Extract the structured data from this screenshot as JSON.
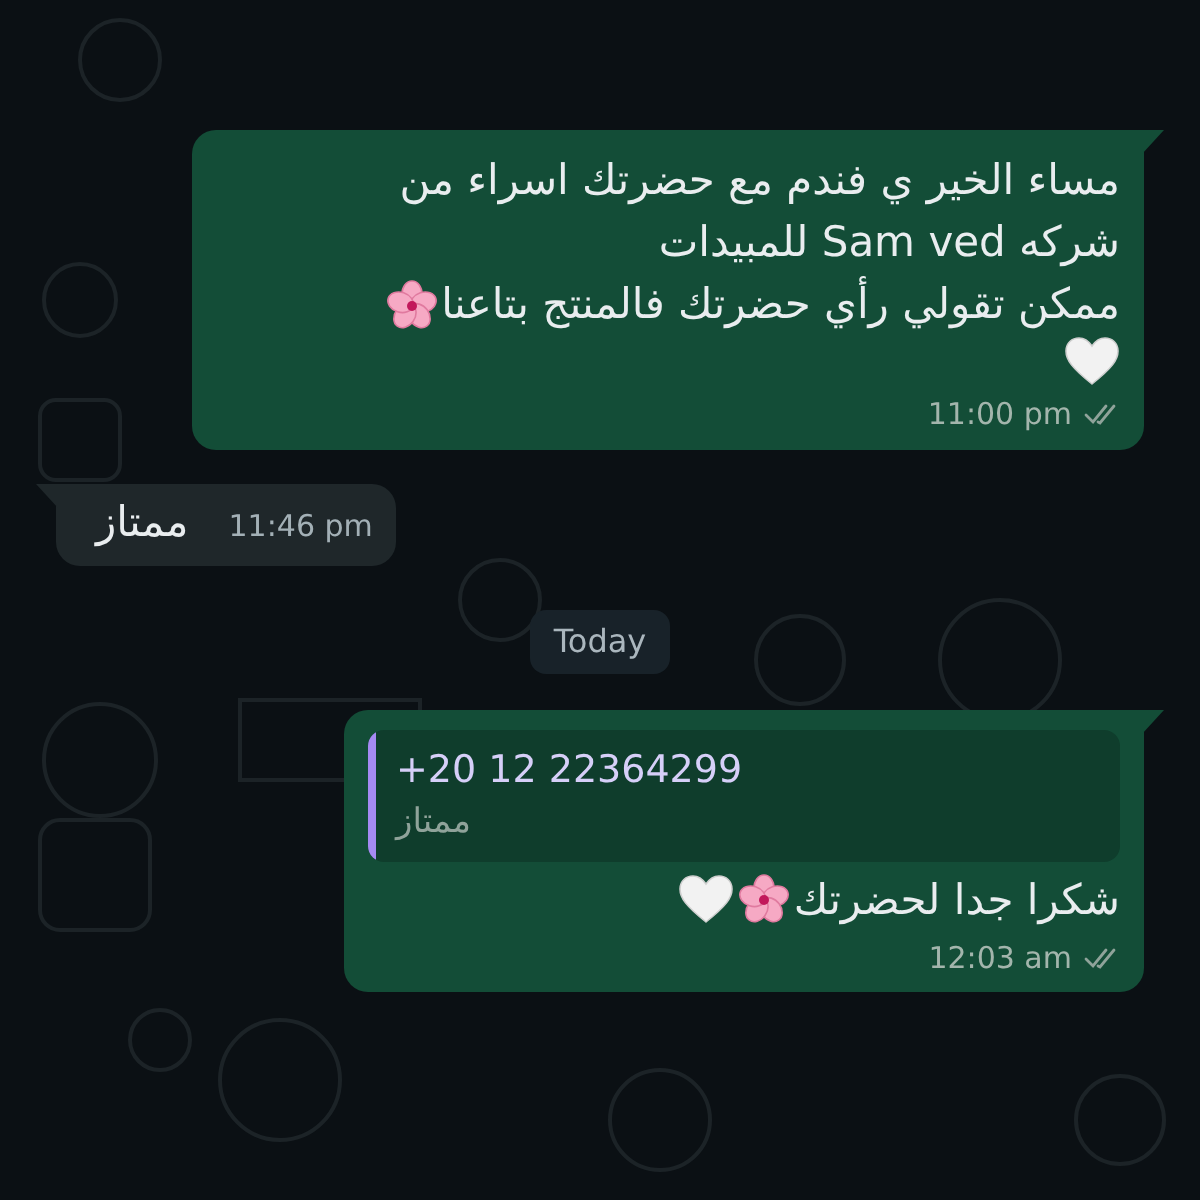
{
  "messages": [
    {
      "kind": "outgoing",
      "lines": [
        {
          "text": "مساء الخير ي فندم مع حضرتك اسراء من"
        },
        {
          "text": "شركه Sam ved للمبيدات"
        },
        {
          "text": "ممكن تقولي رأي حضرتك فالمنتج بتاعنا",
          "icons": [
            {
              "kind": "flower"
            }
          ]
        },
        {
          "icons": [
            {
              "kind": "heart"
            }
          ]
        }
      ],
      "time": "11:00 pm",
      "read": false
    },
    {
      "kind": "incoming",
      "lines": [
        {
          "text": "ممتاز"
        }
      ],
      "time": "11:46 pm"
    },
    {
      "kind": "date",
      "label": "Today"
    },
    {
      "kind": "outgoing",
      "quote": {
        "author": "+20 12 22364299",
        "text": "ممتاز"
      },
      "lines": [
        {
          "text": "شكرا جدا لحضرتك",
          "icons": [
            {
              "kind": "flower"
            },
            {
              "kind": "heart"
            }
          ]
        }
      ],
      "time": "12:03 am",
      "read": false
    }
  ]
}
